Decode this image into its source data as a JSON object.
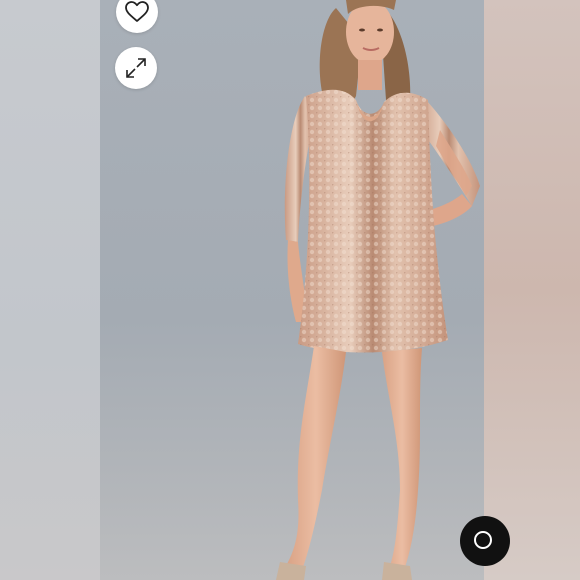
{
  "viewer": {
    "icons": {
      "like": "heart-icon",
      "expand": "expand-arrows-icon",
      "overlay": "circle-button-icon"
    },
    "colors": {
      "backdrop": "#a9b0b8",
      "dress": "#d8b29e",
      "skin": "#e0ab8f",
      "hair": "#8a6547",
      "button": "#ffffff",
      "overlay_button": "#111111"
    }
  }
}
